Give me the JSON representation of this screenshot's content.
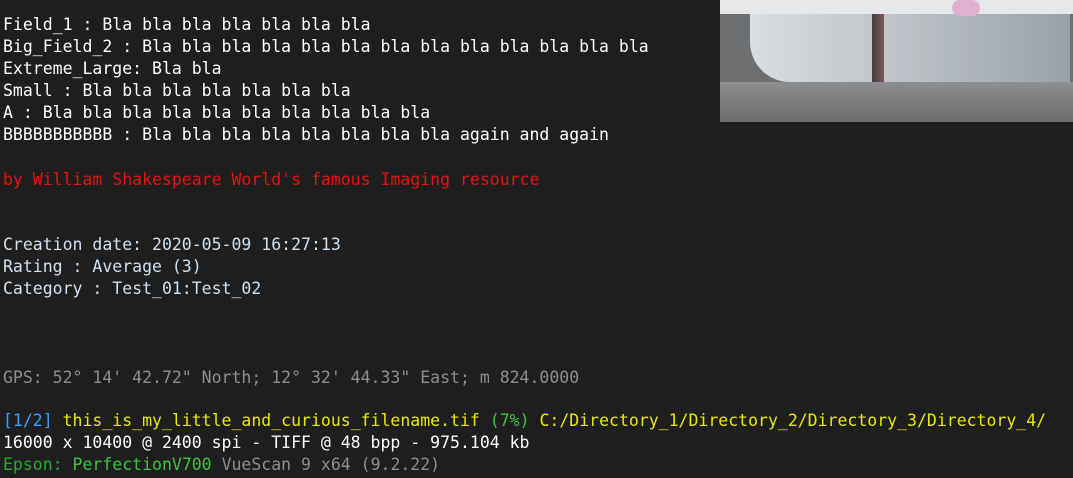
{
  "fields": {
    "l1": "Field_1 : Bla bla bla bla bla bla bla",
    "l2": "Big_Field_2 : Bla bla bla bla bla bla bla bla bla bla bla bla bla",
    "l3": "Extreme_Large: Bla bla",
    "l4": "Small : Bla bla bla bla bla bla bla",
    "l5": "A : Bla bla bla bla bla bla bla bla bla bla",
    "l6": "BBBBBBBBBBB : Bla bla bla bla bla bla bla bla again and again"
  },
  "credit": "by William Shakespeare World's famous Imaging resource",
  "meta": {
    "creation": "Creation date: 2020-05-09 16:27:13",
    "rating": "Rating : Average (3)",
    "category": "Category : Test_01:Test_02"
  },
  "gps": "GPS: 52° 14' 42.72\" North; 12° 32' 44.33\" East; m 824.0000",
  "file": {
    "index": "[1/2]",
    "name": "this_is_my_little_and_curious_filename.tif",
    "percent": "(7%)",
    "path": "C:/Directory_1/Directory_2/Directory_3/Directory_4/",
    "info": "16000 x 10400 @ 2400 spi - TIFF @ 48 bpp - 975.104 kb"
  },
  "scanner": {
    "brand": "Epson:",
    "model": "PerfectionV700",
    "software": "VueScan 9 x64",
    "version": "(9.2.22)"
  },
  "colors": {
    "background": "#1e1e1e",
    "credit": "#e81010",
    "index": "#3aa0ff",
    "filename": "#e8e800",
    "scanner": "#3ec23e"
  }
}
